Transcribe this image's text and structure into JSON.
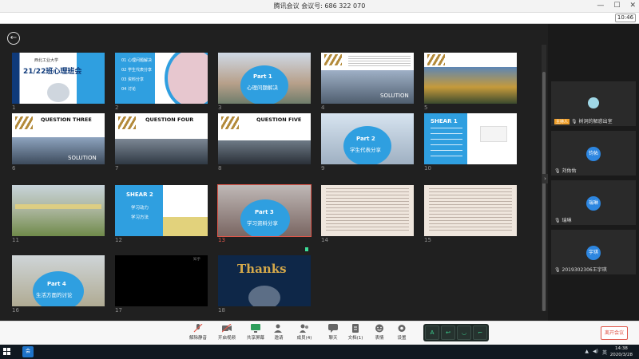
{
  "window": {
    "title": "腾讯会议  会议号: 686 322 070",
    "minimize": "—",
    "maximize": "☐",
    "close": "✕",
    "timer": "10:46"
  },
  "slides": [
    {
      "num": "1",
      "school": "西北工业大学",
      "title": "21/22班心理班会"
    },
    {
      "num": "2",
      "items": [
        "01  心理问题解决",
        "02  学生代表分享",
        "03  资料分享",
        "04  讨论"
      ]
    },
    {
      "num": "3",
      "part": "Part 1",
      "title": "心理问题解决"
    },
    {
      "num": "4",
      "caption": "SOLUTION"
    },
    {
      "num": "5"
    },
    {
      "num": "6",
      "heading": "QUESTION THREE",
      "caption": "SOLUTION"
    },
    {
      "num": "7",
      "heading": "QUESTION FOUR"
    },
    {
      "num": "8",
      "heading": "QUESTION FIVE"
    },
    {
      "num": "9",
      "part": "Part 2",
      "title": "学生代表分享"
    },
    {
      "num": "10",
      "heading": "SHEAR 1"
    },
    {
      "num": "11"
    },
    {
      "num": "12",
      "heading": "SHEAR 2",
      "items": [
        "学习动力",
        "学习方法"
      ]
    },
    {
      "num": "13",
      "part": "Part 3",
      "title": "学习资料分享"
    },
    {
      "num": "14"
    },
    {
      "num": "15"
    },
    {
      "num": "16",
      "part": "Part 4",
      "title": "生活方面的讨论"
    },
    {
      "num": "17",
      "tag": "知乎"
    },
    {
      "num": "18",
      "title": "Thanks"
    }
  ],
  "participants": [
    {
      "name": "树洞的解惑出室",
      "host_tag": "主持人",
      "avatar": ""
    },
    {
      "name": "刘佑佑",
      "avatar": "钧佑"
    },
    {
      "name": "瑞琳",
      "avatar": "瑞琳"
    },
    {
      "name": "2019302306王宇琪",
      "avatar": "宇琪"
    }
  ],
  "toolbar": {
    "mute": "解除静音",
    "video": "开启视频",
    "share": "共享屏幕",
    "invite": "邀请",
    "members": "成员(4)",
    "chat": "聊天",
    "docs": "文档(1)",
    "expression": "表情",
    "settings": "设置",
    "leave": "离开会议"
  },
  "annotation_tools": [
    "A",
    "↩",
    "◡",
    "⌐"
  ],
  "taskbar": {
    "time": "14:38",
    "date": "2020/3/28",
    "app_label": "会",
    "tray_language": "英"
  },
  "colors": {
    "accent": "#2d86e0",
    "danger": "#e0574a",
    "slide_blue": "#2f9fe0",
    "slide_gold": "#b38a3a"
  }
}
